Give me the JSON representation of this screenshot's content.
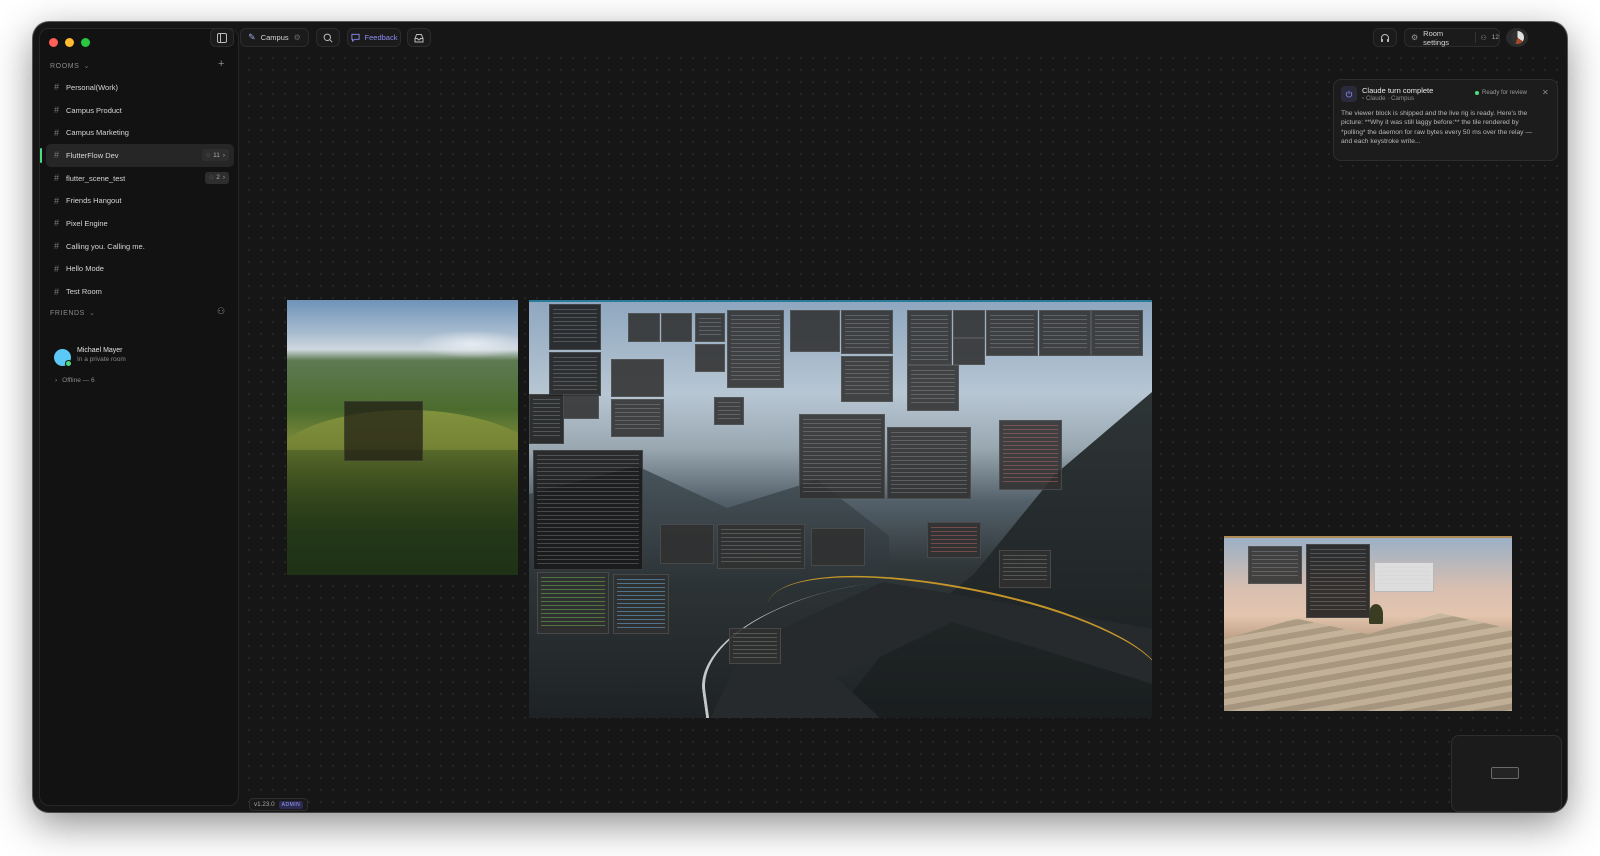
{
  "sidebar": {
    "rooms_header": "ROOMS",
    "rooms": [
      {
        "name": "Personal(Work)"
      },
      {
        "name": "Campus Product"
      },
      {
        "name": "Campus Marketing"
      },
      {
        "name": "FlutterFlow Dev",
        "badge": "11",
        "active": true
      },
      {
        "name": "flutter_scene_test",
        "badge": "2"
      },
      {
        "name": "Friends Hangout"
      },
      {
        "name": "Pixel Engine"
      },
      {
        "name": "Calling you. Calling me."
      },
      {
        "name": "Hello Mode"
      },
      {
        "name": "Test Room"
      }
    ],
    "friends_header": "FRIENDS",
    "friend": {
      "name": "Michael Mayer",
      "status": "In a private room"
    },
    "offline_label": "Offline — 6"
  },
  "toolbar": {
    "space_name": "Campus",
    "feedback_label": "Feedback",
    "room_settings_label": "Room settings",
    "participants_count": "12"
  },
  "notification": {
    "title": "Claude turn complete",
    "subtitle": "Claude · Campus",
    "status": "Ready for review",
    "body": "The viewer block is shipped and the live rig is ready. Here's the picture: **Why it was still laggy before:** the tile rendered by *polling* the daemon for raw bytes every 50 ms over the relay — and each keystroke write..."
  },
  "version": {
    "label": "v1.23.0",
    "badge": "ADMIN"
  },
  "colors": {
    "active_indicator": "#4ade80",
    "feedback_accent": "#8b8df5",
    "admin_badge": "#9ea0f5"
  }
}
